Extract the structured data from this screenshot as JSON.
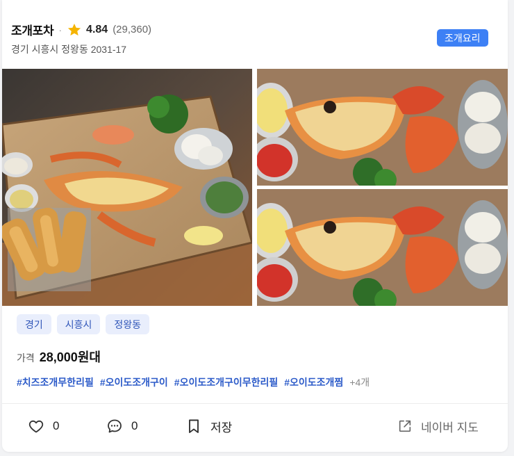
{
  "store": {
    "name": "조개포차",
    "separator": "·",
    "rating": "4.84",
    "review_count": "(29,360)",
    "address": "경기 시흥시 정왕동 2031-17",
    "category": "조개요리"
  },
  "region_tags": [
    "경기",
    "시흥시",
    "정왕동"
  ],
  "price": {
    "label": "가격",
    "value": "28,000원대"
  },
  "hashtags": [
    "#치즈조개무한리필",
    "#오이도조개구이",
    "#오이도조개구이무한리필",
    "#오이도조개찜"
  ],
  "hashtags_more": "+4개",
  "actions": {
    "like_count": "0",
    "comment_count": "0",
    "save_label": "저장",
    "map_label": "네이버 지도"
  },
  "colors": {
    "accent": "#3d80f5",
    "tag_bg": "#e9eefc",
    "tag_text": "#2f55b8",
    "hashtag": "#2c5bc9",
    "star": "#f5b400"
  },
  "icons": {
    "rating": "star-icon",
    "like": "heart-icon",
    "comment": "speech-bubble-icon",
    "save": "bookmark-icon",
    "map": "external-link-icon"
  }
}
